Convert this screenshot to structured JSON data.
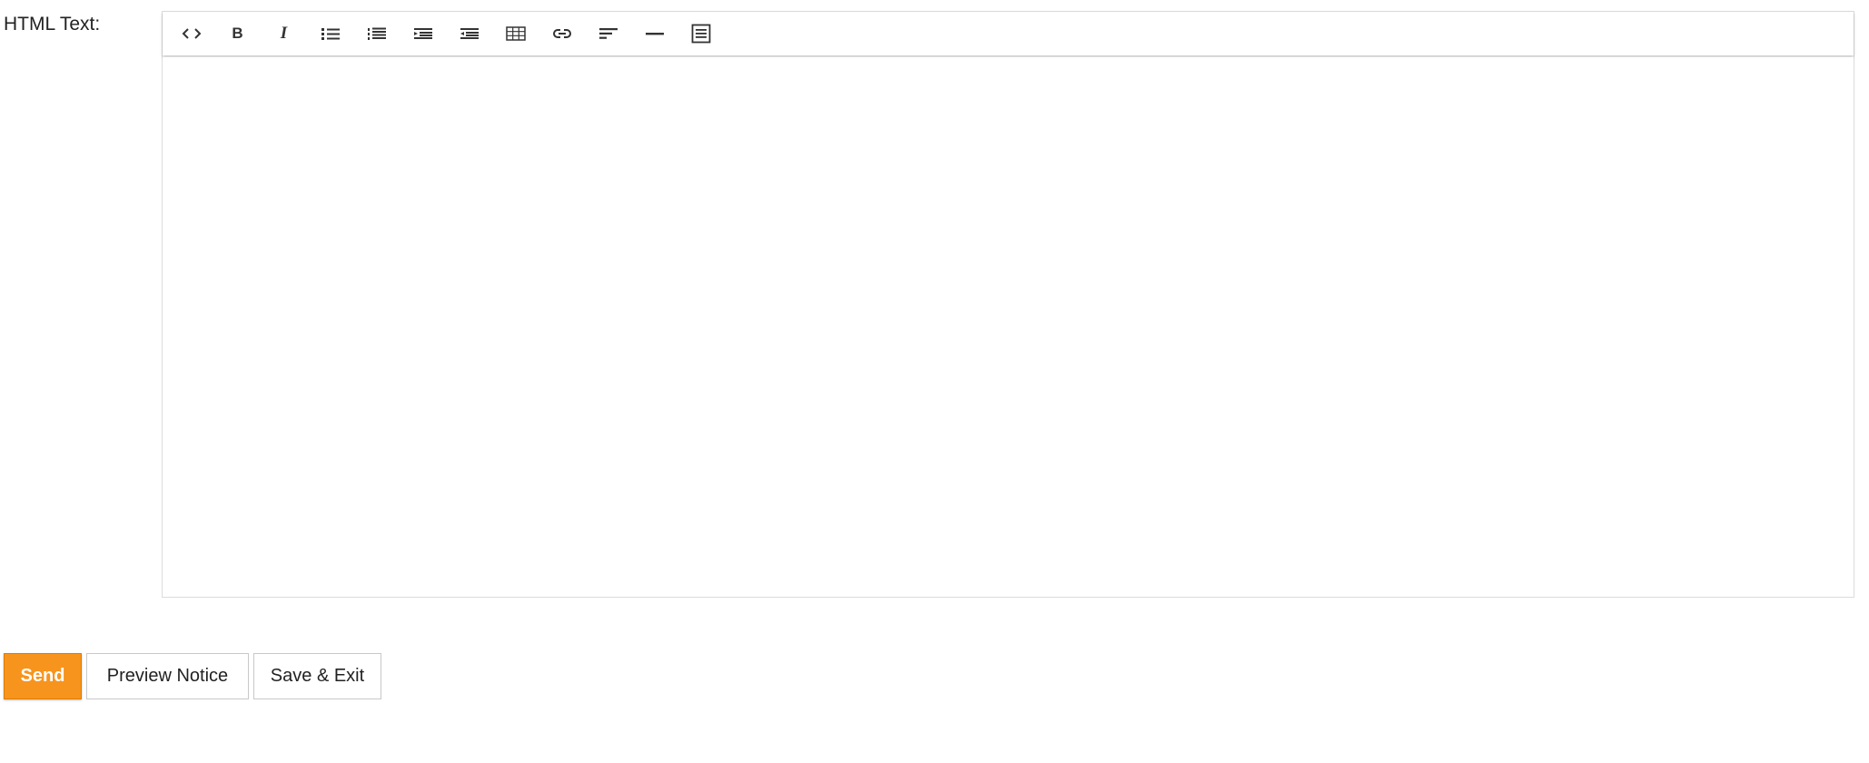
{
  "form": {
    "html_text_label": "HTML Text:"
  },
  "toolbar": {
    "buttons": [
      {
        "name": "code-view",
        "icon": "code-icon"
      },
      {
        "name": "bold",
        "icon": "bold-icon",
        "glyph": "B"
      },
      {
        "name": "italic",
        "icon": "italic-icon",
        "glyph": "I"
      },
      {
        "name": "unordered-list",
        "icon": "bullet-list-icon"
      },
      {
        "name": "ordered-list",
        "icon": "numbered-list-icon"
      },
      {
        "name": "indent",
        "icon": "indent-icon"
      },
      {
        "name": "outdent",
        "icon": "outdent-icon"
      },
      {
        "name": "table",
        "icon": "table-icon"
      },
      {
        "name": "link",
        "icon": "link-icon"
      },
      {
        "name": "align",
        "icon": "align-left-icon"
      },
      {
        "name": "horizontal-rule",
        "icon": "horizontal-rule-icon"
      },
      {
        "name": "fullscreen",
        "icon": "document-icon"
      }
    ]
  },
  "editor": {
    "content": ""
  },
  "actions": {
    "send_label": "Send",
    "preview_label": "Preview Notice",
    "save_exit_label": "Save & Exit"
  },
  "colors": {
    "primary": "#f7941d",
    "primary_border": "#e07c00",
    "icon": "#333333",
    "border": "#dcdcdc"
  }
}
